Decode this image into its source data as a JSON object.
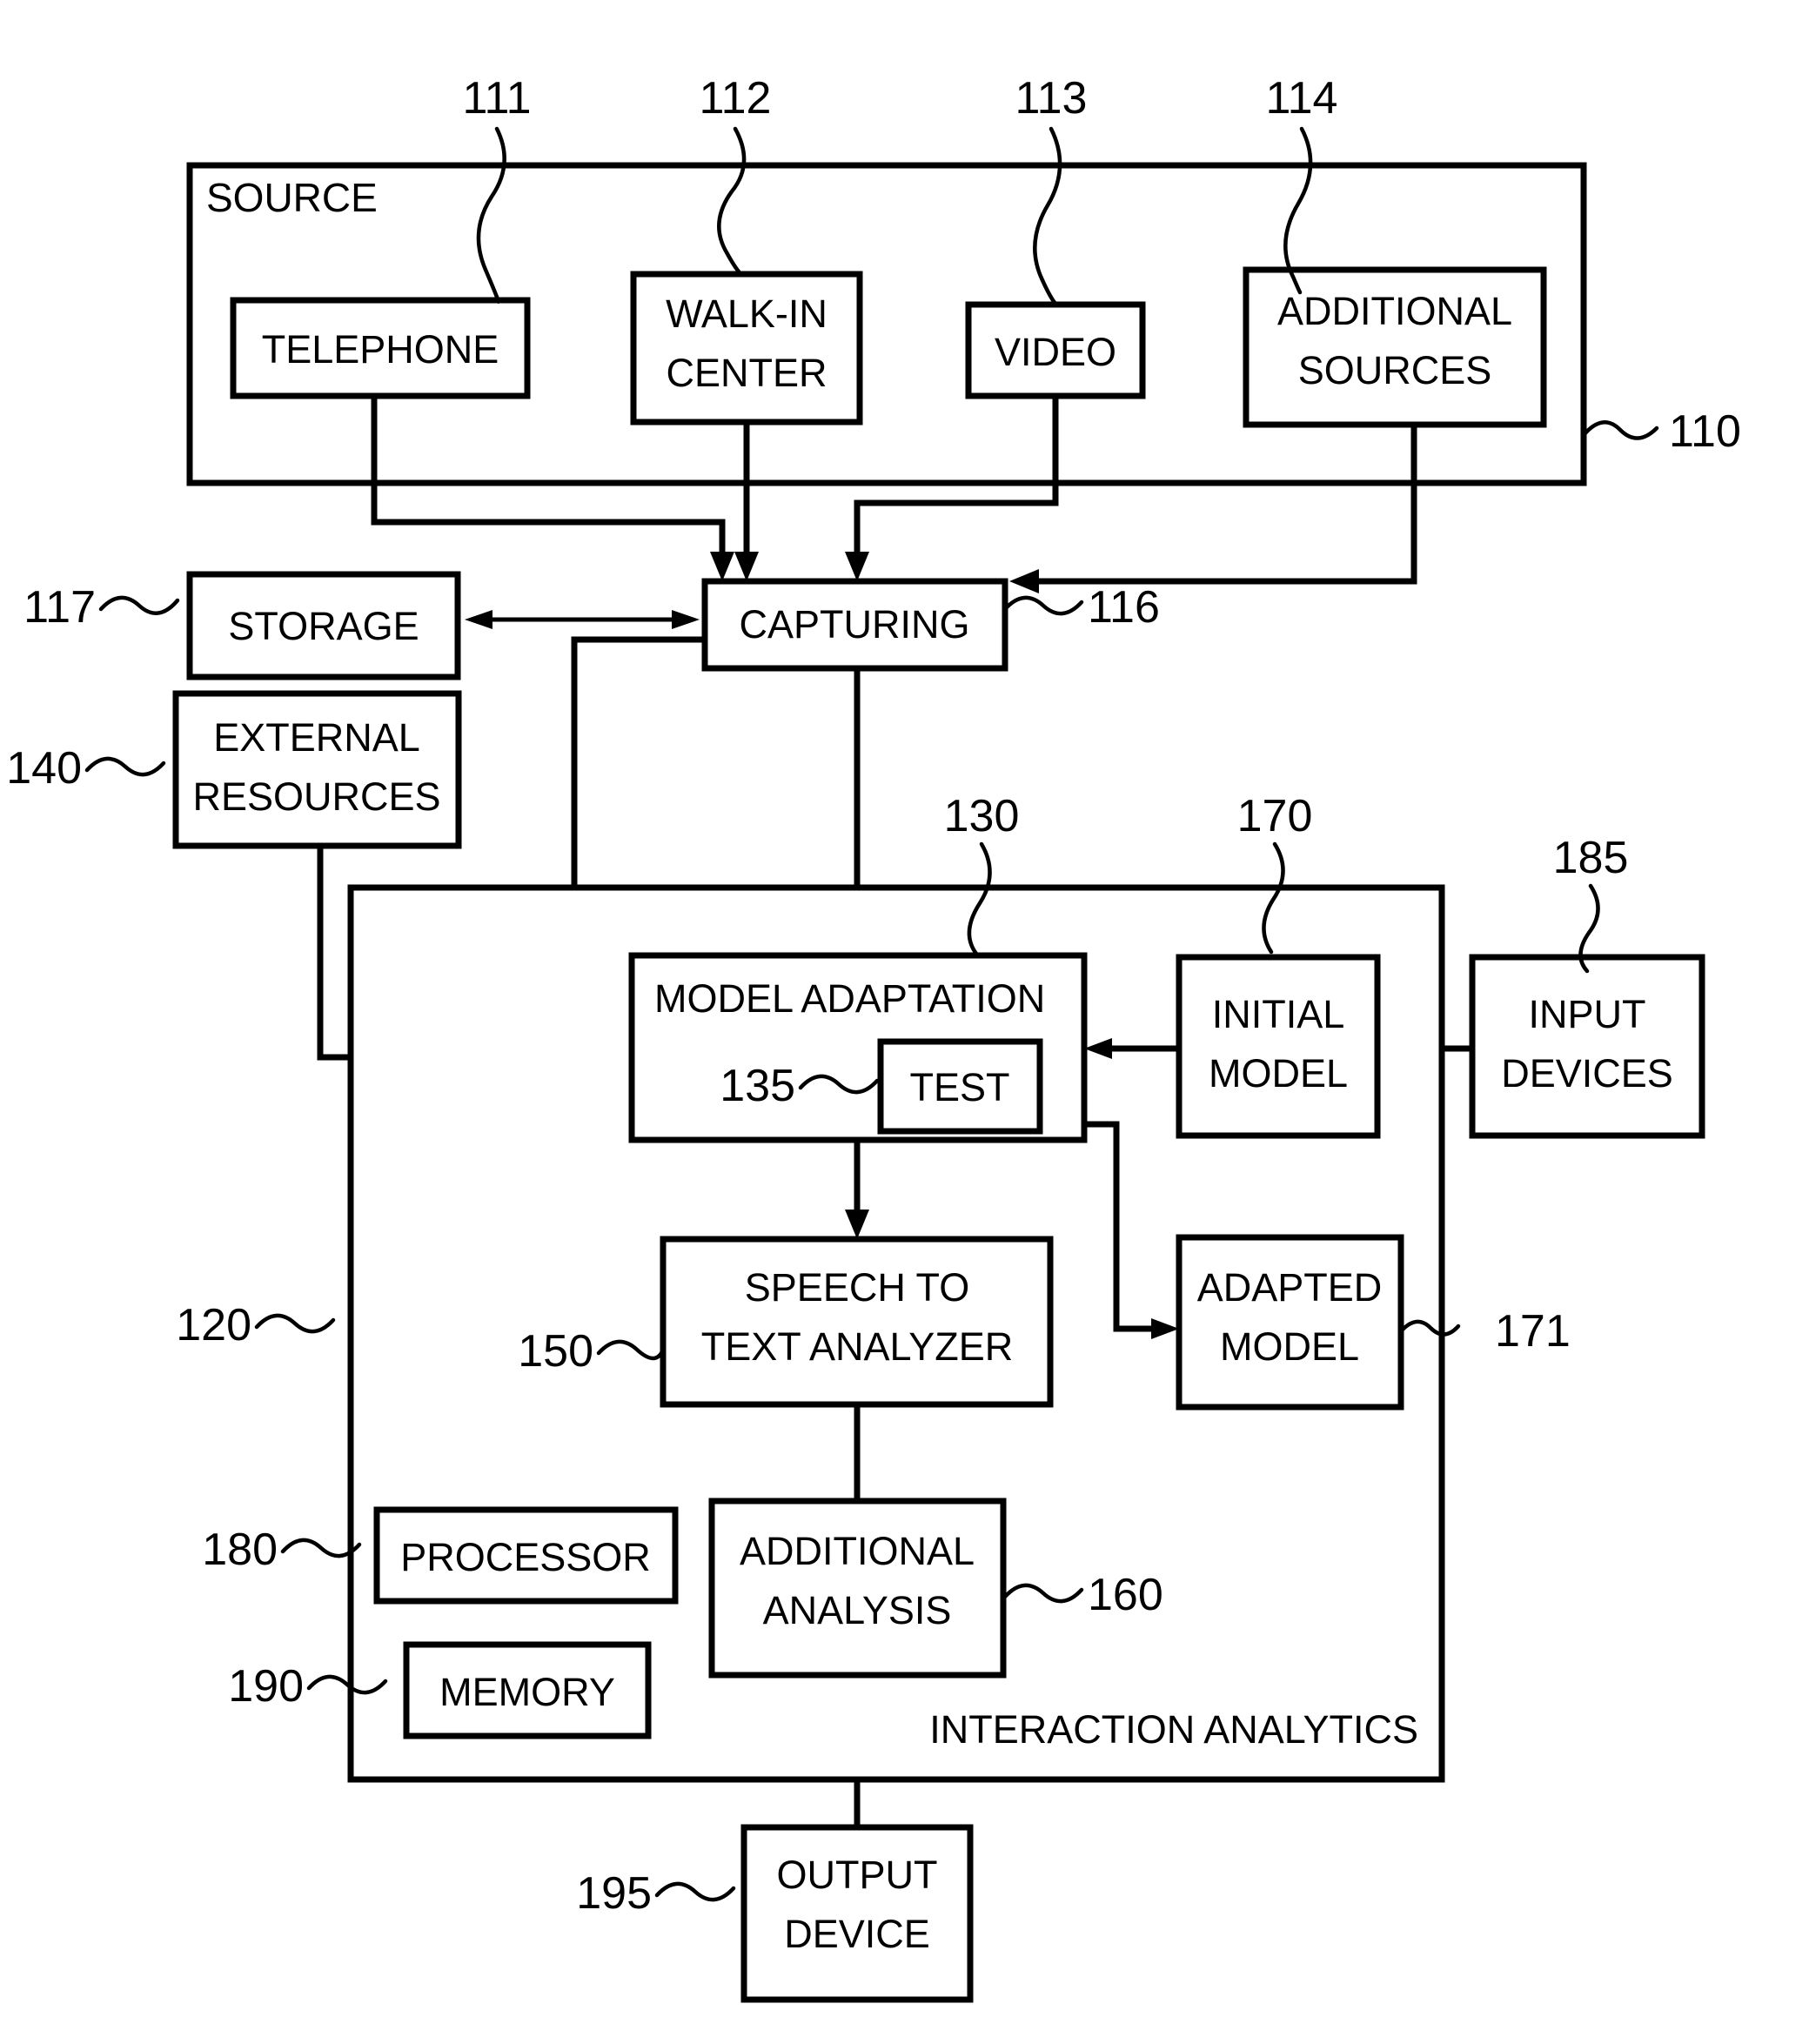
{
  "figure": {
    "type": "patent-block-diagram",
    "title_text": "SOURCE",
    "containers": [
      {
        "id": "source",
        "label": "SOURCE",
        "ref": "110"
      },
      {
        "id": "interaction_analytics",
        "label": "INTERACTION ANALYTICS",
        "ref": "120"
      }
    ]
  },
  "blocks": {
    "telephone": {
      "label": "TELEPHONE",
      "ref": "111"
    },
    "walkin_center": {
      "line1": "WALK-IN",
      "line2": "CENTER",
      "ref": "112"
    },
    "video": {
      "label": "VIDEO",
      "ref": "113"
    },
    "additional_sources": {
      "line1": "ADDITIONAL",
      "line2": "SOURCES",
      "ref": "114"
    },
    "capturing": {
      "label": "CAPTURING",
      "ref": "116"
    },
    "storage": {
      "label": "STORAGE",
      "ref": "117"
    },
    "external_resources": {
      "line1": "EXTERNAL",
      "line2": "RESOURCES",
      "ref": "140"
    },
    "model_adaptation": {
      "label": "MODEL ADAPTATION",
      "ref": "130"
    },
    "test": {
      "label": "TEST",
      "ref": "135"
    },
    "initial_model": {
      "line1": "INITIAL",
      "line2": "MODEL",
      "ref": "170"
    },
    "input_devices": {
      "line1": "INPUT",
      "line2": "DEVICES",
      "ref": "185"
    },
    "speech_to_text_analyzer": {
      "line1": "SPEECH TO",
      "line2": "TEXT ANALYZER",
      "ref": "150"
    },
    "adapted_model": {
      "line1": "ADAPTED",
      "line2": "MODEL",
      "ref": "171"
    },
    "additional_analysis": {
      "line1": "ADDITIONAL",
      "line2": "ANALYSIS",
      "ref": "160"
    },
    "processor": {
      "label": "PROCESSOR",
      "ref": "180"
    },
    "memory": {
      "label": "MEMORY",
      "ref": "190"
    },
    "output_device": {
      "line1": "OUTPUT",
      "line2": "DEVICE",
      "ref": "195"
    },
    "interaction_analytics_label": {
      "label": "INTERACTION ANALYTICS",
      "ref": "120"
    }
  },
  "reference_numerals": {
    "n110": "110",
    "n111": "111",
    "n112": "112",
    "n113": "113",
    "n114": "114",
    "n116": "116",
    "n117": "117",
    "n120": "120",
    "n130": "130",
    "n135": "135",
    "n140": "140",
    "n150": "150",
    "n160": "160",
    "n170": "170",
    "n171": "171",
    "n180": "180",
    "n185": "185",
    "n190": "190",
    "n195": "195"
  },
  "colors": {
    "stroke": "#000000",
    "background": "#ffffff"
  }
}
